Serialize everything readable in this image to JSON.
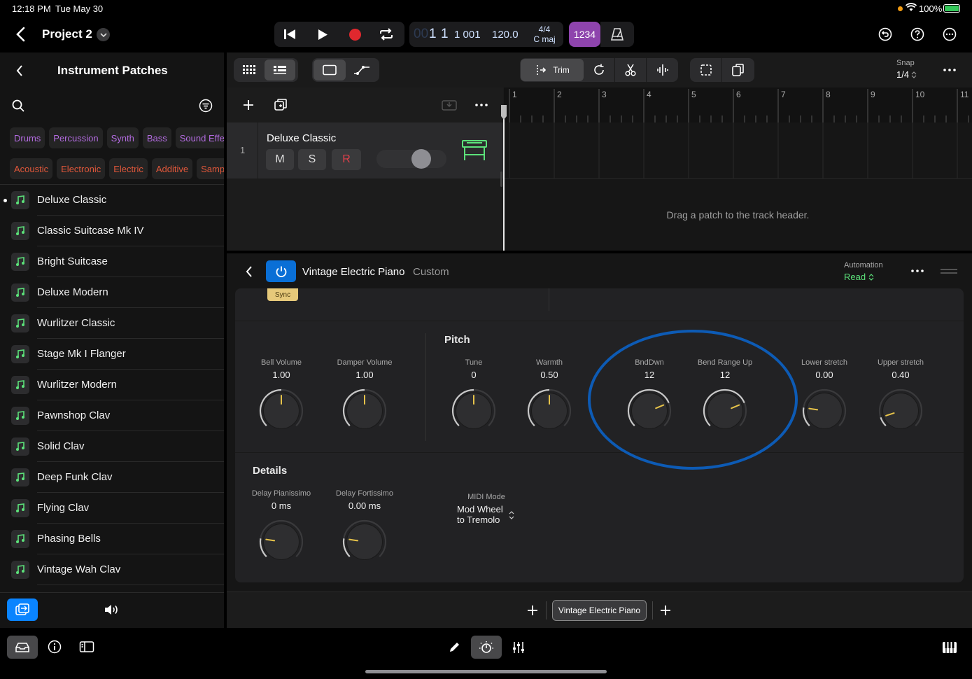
{
  "status": {
    "time": "12:18 PM",
    "date": "Tue May 30",
    "battery": "100%"
  },
  "header": {
    "project_title": "Project 2"
  },
  "lcd": {
    "bars": "1",
    "beats": "1",
    "sub": "1 001",
    "tempo": "120.0",
    "signature": "4/4",
    "key": "C maj",
    "count_in": "1234"
  },
  "toolbar": {
    "trim_label": "Trim",
    "snap_label": "Snap",
    "snap_value": "1/4"
  },
  "sidebar": {
    "title": "Instrument Patches",
    "tags_row1": [
      "Drums",
      "Percussion",
      "Synth",
      "Bass",
      "Sound Effects"
    ],
    "tags_row2": [
      "Acoustic",
      "Electronic",
      "Electric",
      "Additive",
      "Sampled"
    ],
    "patches": [
      "Deluxe Classic",
      "Classic Suitcase Mk IV",
      "Bright Suitcase",
      "Deluxe Modern",
      "Wurlitzer Classic",
      "Stage Mk I Flanger",
      "Wurlitzer Modern",
      "Pawnshop Clav",
      "Solid Clav",
      "Deep Funk Clav",
      "Flying Clav",
      "Phasing Bells",
      "Vintage Wah Clav"
    ]
  },
  "track": {
    "number": "1",
    "name": "Deluxe Classic",
    "mute": "M",
    "solo": "S",
    "record": "R"
  },
  "ruler": {
    "bars": [
      "1",
      "2",
      "3",
      "4",
      "5",
      "6",
      "7",
      "8",
      "9",
      "10",
      "11"
    ]
  },
  "timeline": {
    "hint": "Drag a patch to the track header."
  },
  "plugin": {
    "name": "Vintage Electric Piano",
    "preset": "Custom",
    "automation_label": "Automation",
    "automation_value": "Read",
    "sync_label": "Sync",
    "pitch_title": "Pitch",
    "details_title": "Details",
    "knobs": [
      {
        "label": "Bell Volume",
        "value": "1.00",
        "level": 0.5
      },
      {
        "label": "Damper Volume",
        "value": "1.00",
        "level": 0.5
      },
      {
        "label": "Tune",
        "value": "0",
        "level": 0.5
      },
      {
        "label": "Warmth",
        "value": "0.50",
        "level": 0.5
      },
      {
        "label": "BndDwn",
        "value": "12",
        "level": 0.75
      },
      {
        "label": "Bend Range Up",
        "value": "12",
        "level": 0.75
      },
      {
        "label": "Lower stretch",
        "value": "0.00",
        "level": 0.2
      },
      {
        "label": "Upper stretch",
        "value": "0.40",
        "level": 0.1
      }
    ],
    "details": [
      {
        "label": "Delay Pianissimo",
        "value": "0 ms",
        "level": 0.2
      },
      {
        "label": "Delay Fortissimo",
        "value": "0.00 ms",
        "level": 0.2
      }
    ],
    "midi_mode_label": "MIDI Mode",
    "midi_mode_value_1": "Mod Wheel",
    "midi_mode_value_2": "to Tremolo",
    "slot_label": "Vintage Electric Piano"
  },
  "colors": {
    "accent_blue": "#0a84ff",
    "purple": "#8e44ad",
    "tag_purple": "#b36be0",
    "tag_orange": "#e0573a",
    "highlight_circle": "#0d5bb5",
    "knob_indicator": "#e6c34a"
  }
}
